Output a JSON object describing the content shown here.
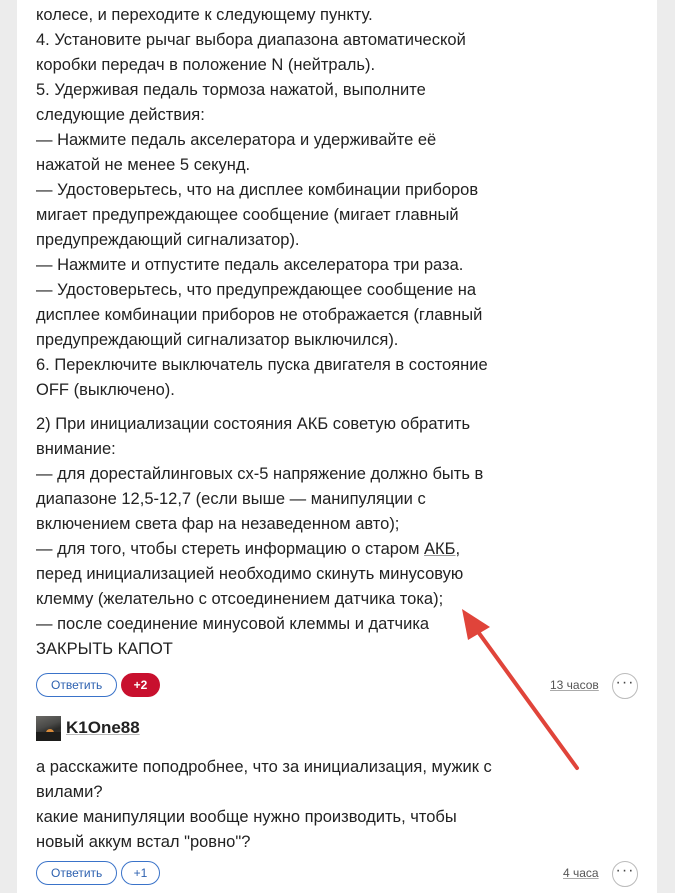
{
  "comment1": {
    "lines_a": [
      "колесе, и переходите к следующему пункту.",
      "4. Установите рычаг выбора диапазона автоматической",
      "коробки передач в положение N (нейтраль).",
      "5. Удерживая педаль тормоза нажатой, выполните",
      "следующие действия:",
      "— Нажмите педаль акселератора и удерживайте её",
      "нажатой не менее 5 секунд.",
      "— Удостоверьтесь, что на дисплее комбинации приборов",
      "мигает предупреждающее сообщение (мигает главный",
      "предупреждающий сигнализатор).",
      "— Нажмите и отпустите педаль акселератора три раза.",
      "— Удостоверьтесь, что предупреждающее сообщение на",
      "дисплее комбинации приборов не отображается (главный",
      "предупреждающий сигнализатор выключился).",
      "6. Переключите выключатель пуска двигателя в состояние",
      "OFF (выключено)."
    ],
    "lines_b": [
      "2) При инициализации состояния АКБ советую обратить",
      "внимание:",
      "— для дорестайлинговых сх-5 напряжение должно быть в",
      "диапазоне 12,5-12,7 (если выше — манипуляции с",
      "включением света фар на незаведенном авто);"
    ],
    "line_akb_prefix": "— для того, чтобы стереть информацию о старом ",
    "line_akb_word": "АКБ",
    "line_akb_suffix": ",",
    "lines_c": [
      "перед инициализацией необходимо скинуть минусовую",
      "клемму (желательно с отсоединением датчика тока);",
      "— после соединение минусовой клеммы и датчика",
      "ЗАКРЫТЬ КАПОТ"
    ],
    "reply_label": "Ответить",
    "votes": "+2",
    "time": "13 часов",
    "more": "···"
  },
  "comment2": {
    "author": "K1One88",
    "lines": [
      "а расскажите поподробнее, что за инициализация, мужик с",
      "вилами?",
      "какие манипуляции вообще нужно производить, чтобы",
      "новый аккум встал \"ровно\"?"
    ],
    "reply_label": "Ответить",
    "votes": "+1",
    "time": "4 часа",
    "more": "···"
  },
  "colors": {
    "accent": "#3a73c9",
    "vote_badge": "#c8102e",
    "arrow": "#e0443a"
  },
  "icons": [
    "more-dots-icon",
    "avatar-image",
    "red-arrow-annotation"
  ]
}
